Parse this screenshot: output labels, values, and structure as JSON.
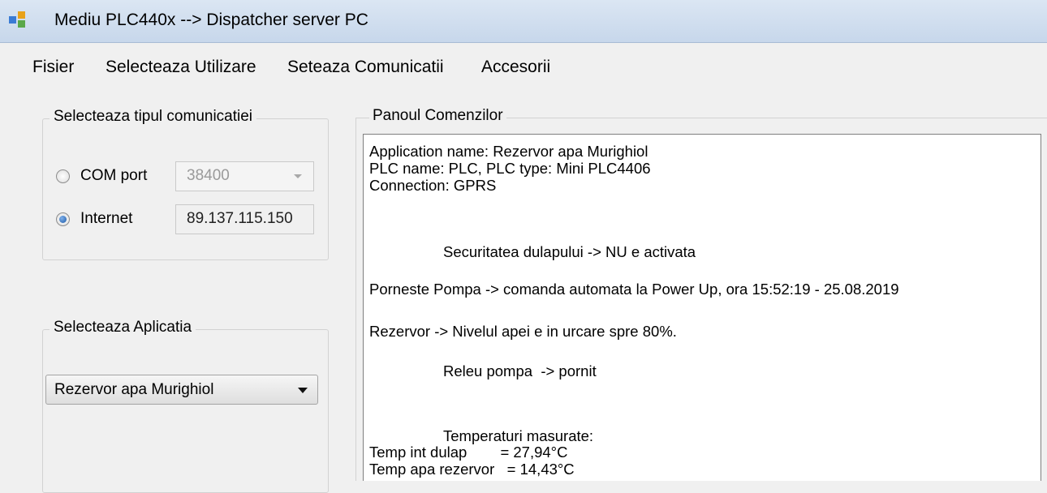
{
  "window": {
    "title": "Mediu PLC440x --> Dispatcher server PC",
    "icon": "app-window-icon"
  },
  "menu": {
    "items": [
      "Fisier",
      "Selecteaza Utilizare",
      "Seteaza Comunicatii",
      "Accesorii"
    ]
  },
  "communication": {
    "group_title": "Selecteaza tipul comunicatiei",
    "com_port_label": "COM port",
    "com_port_value": "38400",
    "com_port_selected": false,
    "internet_label": "Internet",
    "internet_value": "89.137.115.150",
    "internet_selected": true
  },
  "application": {
    "group_title": "Selecteaza Aplicatia",
    "selected": "Rezervor apa Murighiol"
  },
  "commands_panel": {
    "title": "Panoul Comenzilor",
    "lines": [
      "Application name: Rezervor apa Murighiol",
      "PLC name: PLC, PLC type: Mini PLC4406",
      "Connection: GPRS",
      "Securitatea dulapului -> NU e activata",
      "Porneste Pompa -> comanda automata la Power Up, ora 15:52:19 - 25.08.2019",
      "Rezervor -> Nivelul apei e in urcare spre 80%.",
      "Releu pompa  -> pornit",
      "Temperaturi masurate:",
      "Temp int dulap        = 27,94°C",
      "Temp apa rezervor   = 14,43°C"
    ]
  },
  "colors": {
    "title_bar": "#c7d7eb",
    "window_bg": "#f0f0f0",
    "radio_selected": "#1d5aa8"
  }
}
